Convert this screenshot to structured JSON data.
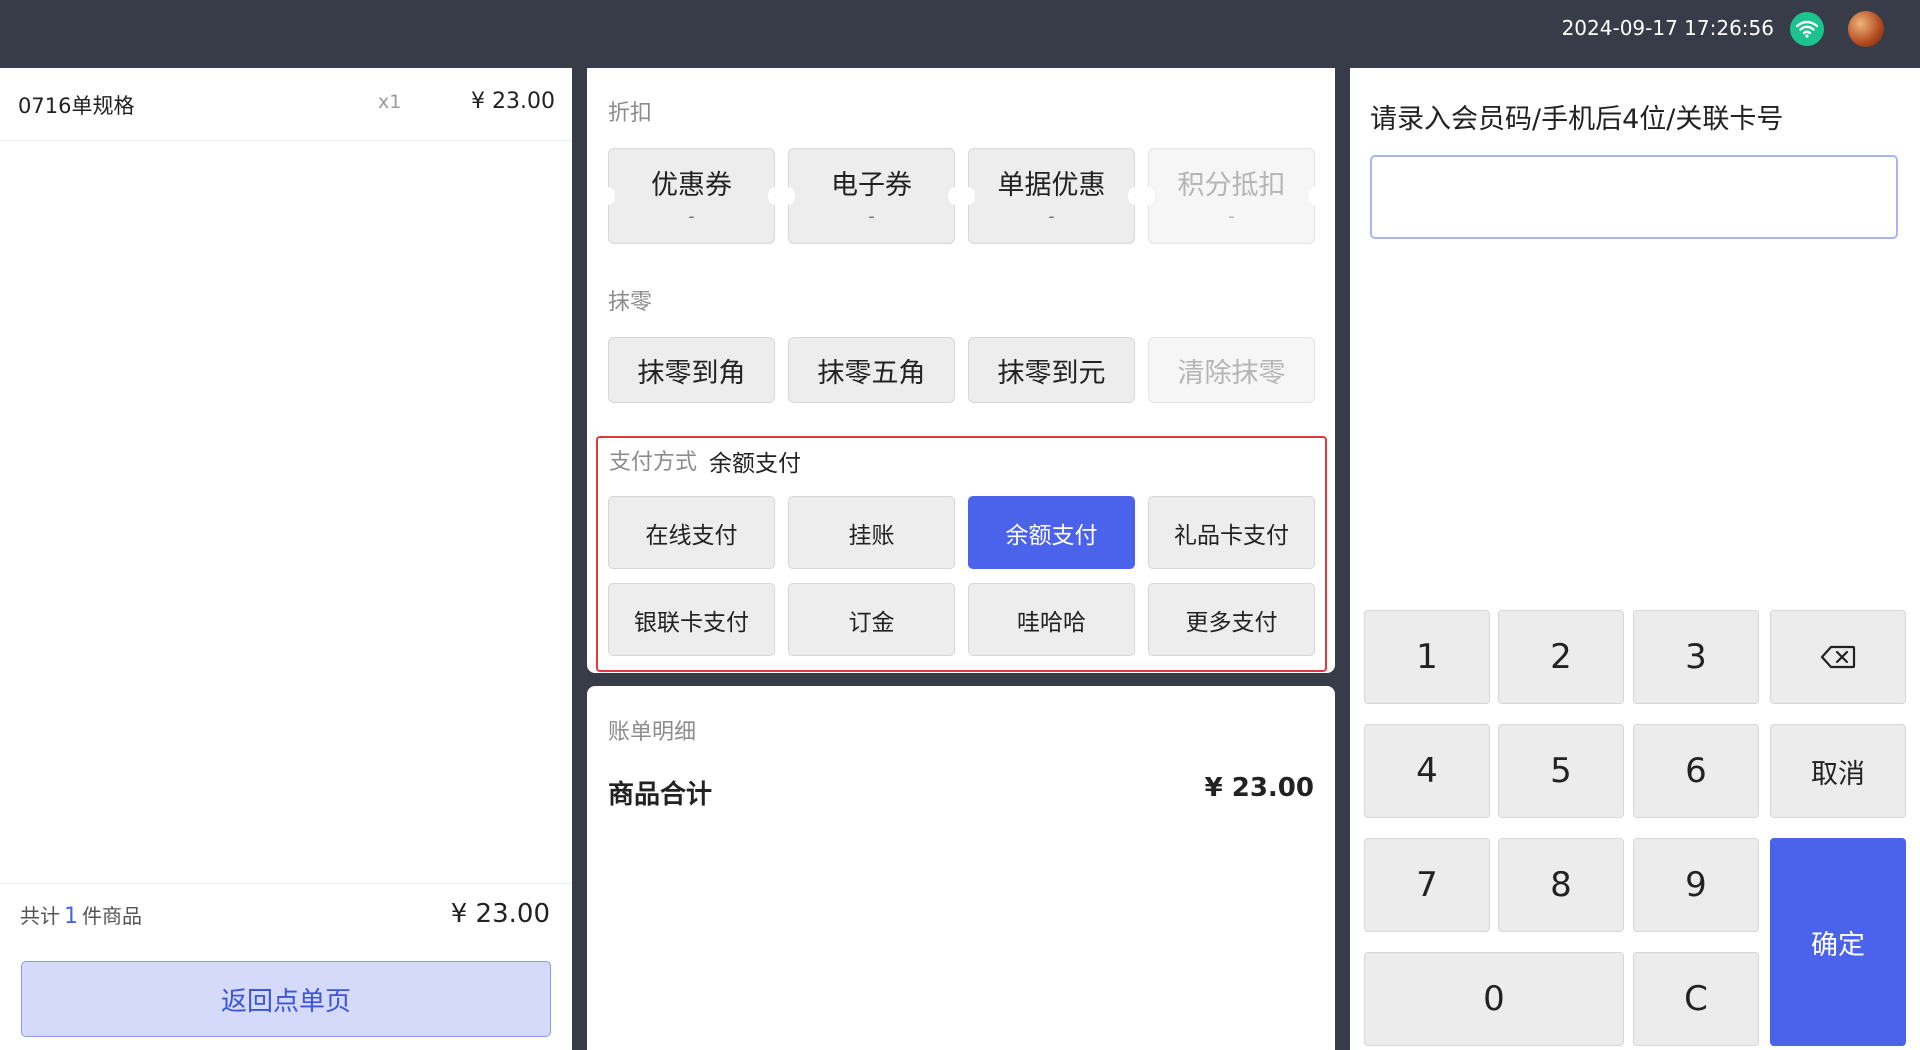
{
  "header": {
    "datetime": "2024-09-17 17:26:56"
  },
  "order": {
    "items": [
      {
        "name": "0716单规格",
        "qty": "x1",
        "price": "¥ 23.00"
      }
    ],
    "summary_prefix": "共计",
    "summary_count": "1",
    "summary_suffix": "件商品",
    "summary_total": "¥ 23.00",
    "back_label": "返回点单页"
  },
  "discount": {
    "title": "折扣",
    "buttons": [
      {
        "label": "优惠券",
        "sub": "-"
      },
      {
        "label": "电子券",
        "sub": "-"
      },
      {
        "label": "单据优惠",
        "sub": "-"
      },
      {
        "label": "积分抵扣",
        "sub": "-",
        "disabled": true
      }
    ]
  },
  "rounding": {
    "title": "抹零",
    "buttons": [
      {
        "label": "抹零到角"
      },
      {
        "label": "抹零五角"
      },
      {
        "label": "抹零到元"
      },
      {
        "label": "清除抹零",
        "disabled": true
      }
    ]
  },
  "payment": {
    "title": "支付方式",
    "selected": "余额支付",
    "buttons": [
      {
        "label": "在线支付"
      },
      {
        "label": "挂账"
      },
      {
        "label": "余额支付",
        "active": true
      },
      {
        "label": "礼品卡支付"
      },
      {
        "label": "银联卡支付"
      },
      {
        "label": "订金"
      },
      {
        "label": "哇哈哈"
      },
      {
        "label": "更多支付"
      }
    ]
  },
  "bill": {
    "title": "账单明细",
    "subtotal_label": "商品合计",
    "subtotal_value": "¥ 23.00"
  },
  "member": {
    "title": "请录入会员码/手机后4位/关联卡号",
    "input_value": "",
    "input_placeholder": ""
  },
  "keypad": {
    "k1": "1",
    "k2": "2",
    "k3": "3",
    "k4": "4",
    "k5": "5",
    "k6": "6",
    "k7": "7",
    "k8": "8",
    "k9": "9",
    "k0": "0",
    "clear": "C",
    "cancel": "取消",
    "confirm": "确定",
    "backspace_icon": "backspace-icon"
  },
  "colors": {
    "accent": "#4b63eb",
    "header_bg": "#383b48",
    "highlight_border": "#e53935",
    "wifi": "#1cc38f"
  }
}
